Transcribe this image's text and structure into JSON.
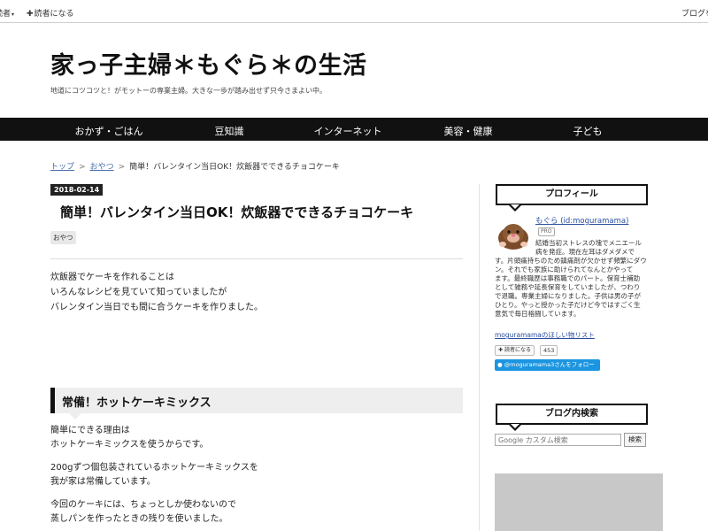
{
  "topbar": {
    "left_menu": "読者",
    "reader_button": "読者になる",
    "right_link": "ブログを"
  },
  "header": {
    "site_title": "家っ子主婦＊もぐら＊の生活",
    "site_description": "地道にコツコツと！がモットーの専業主婦。大きな一歩が踏み出せず只今さまよい中。"
  },
  "nav": {
    "items": [
      "おかず・ごはん",
      "豆知識",
      "インターネット",
      "美容・健康",
      "子ども"
    ]
  },
  "breadcrumb": {
    "home": "トップ",
    "separator": ">",
    "category": "おやつ",
    "current": "簡単！バレンタイン当日OK！炊飯器でできるチョコケーキ"
  },
  "article": {
    "date": "2018-02-14",
    "title": "簡単！バレンタイン当日OK！炊飯器でできるチョコケーキ",
    "category_tag": "おやつ",
    "intro": [
      "炊飯器でケーキを作れることは",
      "いろんなレシピを見ていて知っていましたが",
      "バレンタイン当日でも間に合うケーキを作りました。"
    ],
    "section_heading": "常備！ホットケーキミックス",
    "paragraphs": [
      [
        "簡単にできる理由は",
        "ホットケーキミックスを使うからです。"
      ],
      [
        "200gずつ個包装されているホットケーキミックスを",
        "我が家は常備しています。"
      ],
      [
        "今回のケーキには、ちょっとしか使わないので",
        "蒸しパンを作ったときの残りを使いました。"
      ]
    ]
  },
  "sidebar": {
    "profile": {
      "heading": "プロフィール",
      "name": "もぐら (id:moguramama)",
      "badge": "PRO",
      "bio_lines": [
        "結婚当初ストレスの塊でメニエール",
        "病を発症。現在左耳はダメダメで",
        "す。片頭痛持ちのため鎮痛剤が欠かせず頻繁にダウ",
        "ン。それでも家族に助けられてなんとかやって",
        "ます。最終職歴は事務職でのパート。保育士補助",
        "として雑務や延長保育をしていましたが、つわり",
        "で退職。専業主婦になりました。子供は男の子が",
        "ひとり。やっと授かった子だけど今ではすごく生",
        "意気で毎日格闘しています。"
      ],
      "wishlist": "moguramamaのほしい物リスト",
      "reader_button": "読者になる",
      "reader_count": "453",
      "twitter_button": "@moguramama3さんをフォロー"
    },
    "search": {
      "heading": "ブログ内検索",
      "placeholder": "Google カスタム検索",
      "button": "検索"
    }
  },
  "colors": {
    "nav_background": "#111111",
    "link": "#2a4fa0",
    "twitter": "#1b95e0",
    "section_heading_bg": "#eeeeee"
  }
}
